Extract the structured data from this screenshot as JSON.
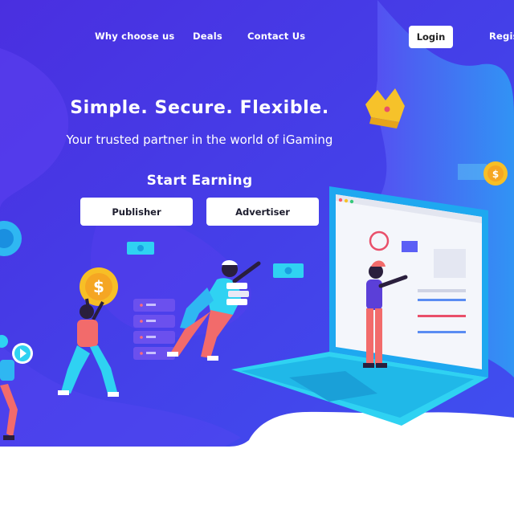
{
  "nav": {
    "links": [
      "Why choose us",
      "Deals",
      "Contact Us"
    ],
    "login_label": "Login",
    "register_label": "Regis"
  },
  "hero": {
    "title": "Simple. Secure. Flexible.",
    "subtitle": "Your trusted partner in the world of iGaming",
    "start_title": "Start Earning",
    "publisher_label": "Publisher",
    "advertiser_label": "Advertiser"
  },
  "colors": {
    "hero_bg": "#4a35e8",
    "hero_blob": "#6a55f5",
    "accent_cyan": "#2fd2f2",
    "laptop_blue": "#1ea8f0",
    "coin_gold": "#f7bf26",
    "figure_red": "#f26b6b"
  }
}
